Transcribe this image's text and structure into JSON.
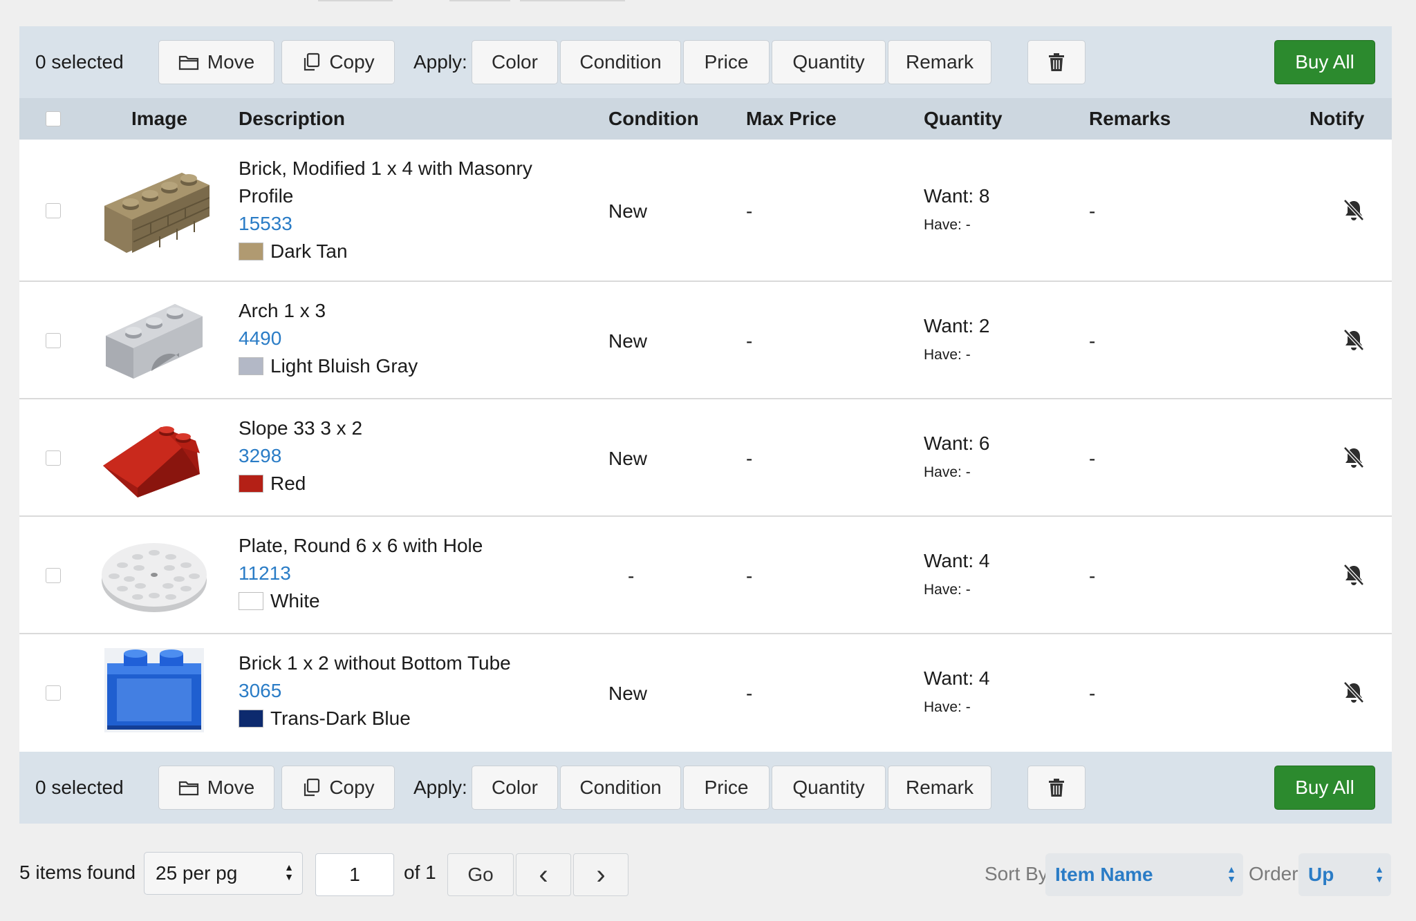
{
  "toolbar": {
    "selected_count": "0 selected",
    "move_label": "Move",
    "copy_label": "Copy",
    "apply_label": "Apply:",
    "apply_buttons": [
      "Color",
      "Condition",
      "Price",
      "Quantity",
      "Remark"
    ],
    "buy_all_label": "Buy All"
  },
  "table": {
    "headers": [
      "Image",
      "Description",
      "Condition",
      "Max Price",
      "Quantity",
      "Remarks",
      "Notify"
    ],
    "rows": [
      {
        "name_line1": "Brick, Modified 1 x 4 with Masonry",
        "name_line2": "Profile",
        "part_id": "15533",
        "color_name": "Dark Tan",
        "color_hex": "#b09a71",
        "condition": "New",
        "max_price": "-",
        "want": "Want: 8",
        "have": "Have: -",
        "remarks": "-"
      },
      {
        "name_line1": "Arch 1 x 3",
        "name_line2": "",
        "part_id": "4490",
        "color_name": "Light Bluish Gray",
        "color_hex": "#b3b8c6",
        "condition": "New",
        "max_price": "-",
        "want": "Want: 2",
        "have": "Have: -",
        "remarks": "-"
      },
      {
        "name_line1": "Slope 33 3 x 2",
        "name_line2": "",
        "part_id": "3298",
        "color_name": "Red",
        "color_hex": "#b42016",
        "condition": "New",
        "max_price": "-",
        "want": "Want: 6",
        "have": "Have: -",
        "remarks": "-"
      },
      {
        "name_line1": "Plate, Round 6 x 6 with Hole",
        "name_line2": "",
        "part_id": "11213",
        "color_name": "White",
        "color_hex": "#ffffff",
        "condition": "-",
        "max_price": "-",
        "want": "Want: 4",
        "have": "Have: -",
        "remarks": "-"
      },
      {
        "name_line1": "Brick 1 x 2 without Bottom Tube",
        "name_line2": "",
        "part_id": "3065",
        "color_name": "Trans-Dark Blue",
        "color_hex": "#0d2a6e",
        "condition": "New",
        "max_price": "-",
        "want": "Want: 4",
        "have": "Have: -",
        "remarks": "-"
      }
    ]
  },
  "footer": {
    "items_found": "5 items found",
    "per_page": "25 per pg",
    "page_number": "1",
    "of_pages": "of 1",
    "go_label": "Go",
    "prev": "‹",
    "next": "›",
    "sort_by_label": "Sort By",
    "sort_by_value": "Item Name",
    "order_label": "Order",
    "order_value": "Up"
  },
  "colors": {
    "accent": "#2a7cc6",
    "buy": "#2c8a2e",
    "toolbar_bg": "#d9e2ea",
    "header_bg": "#cdd7e0"
  }
}
